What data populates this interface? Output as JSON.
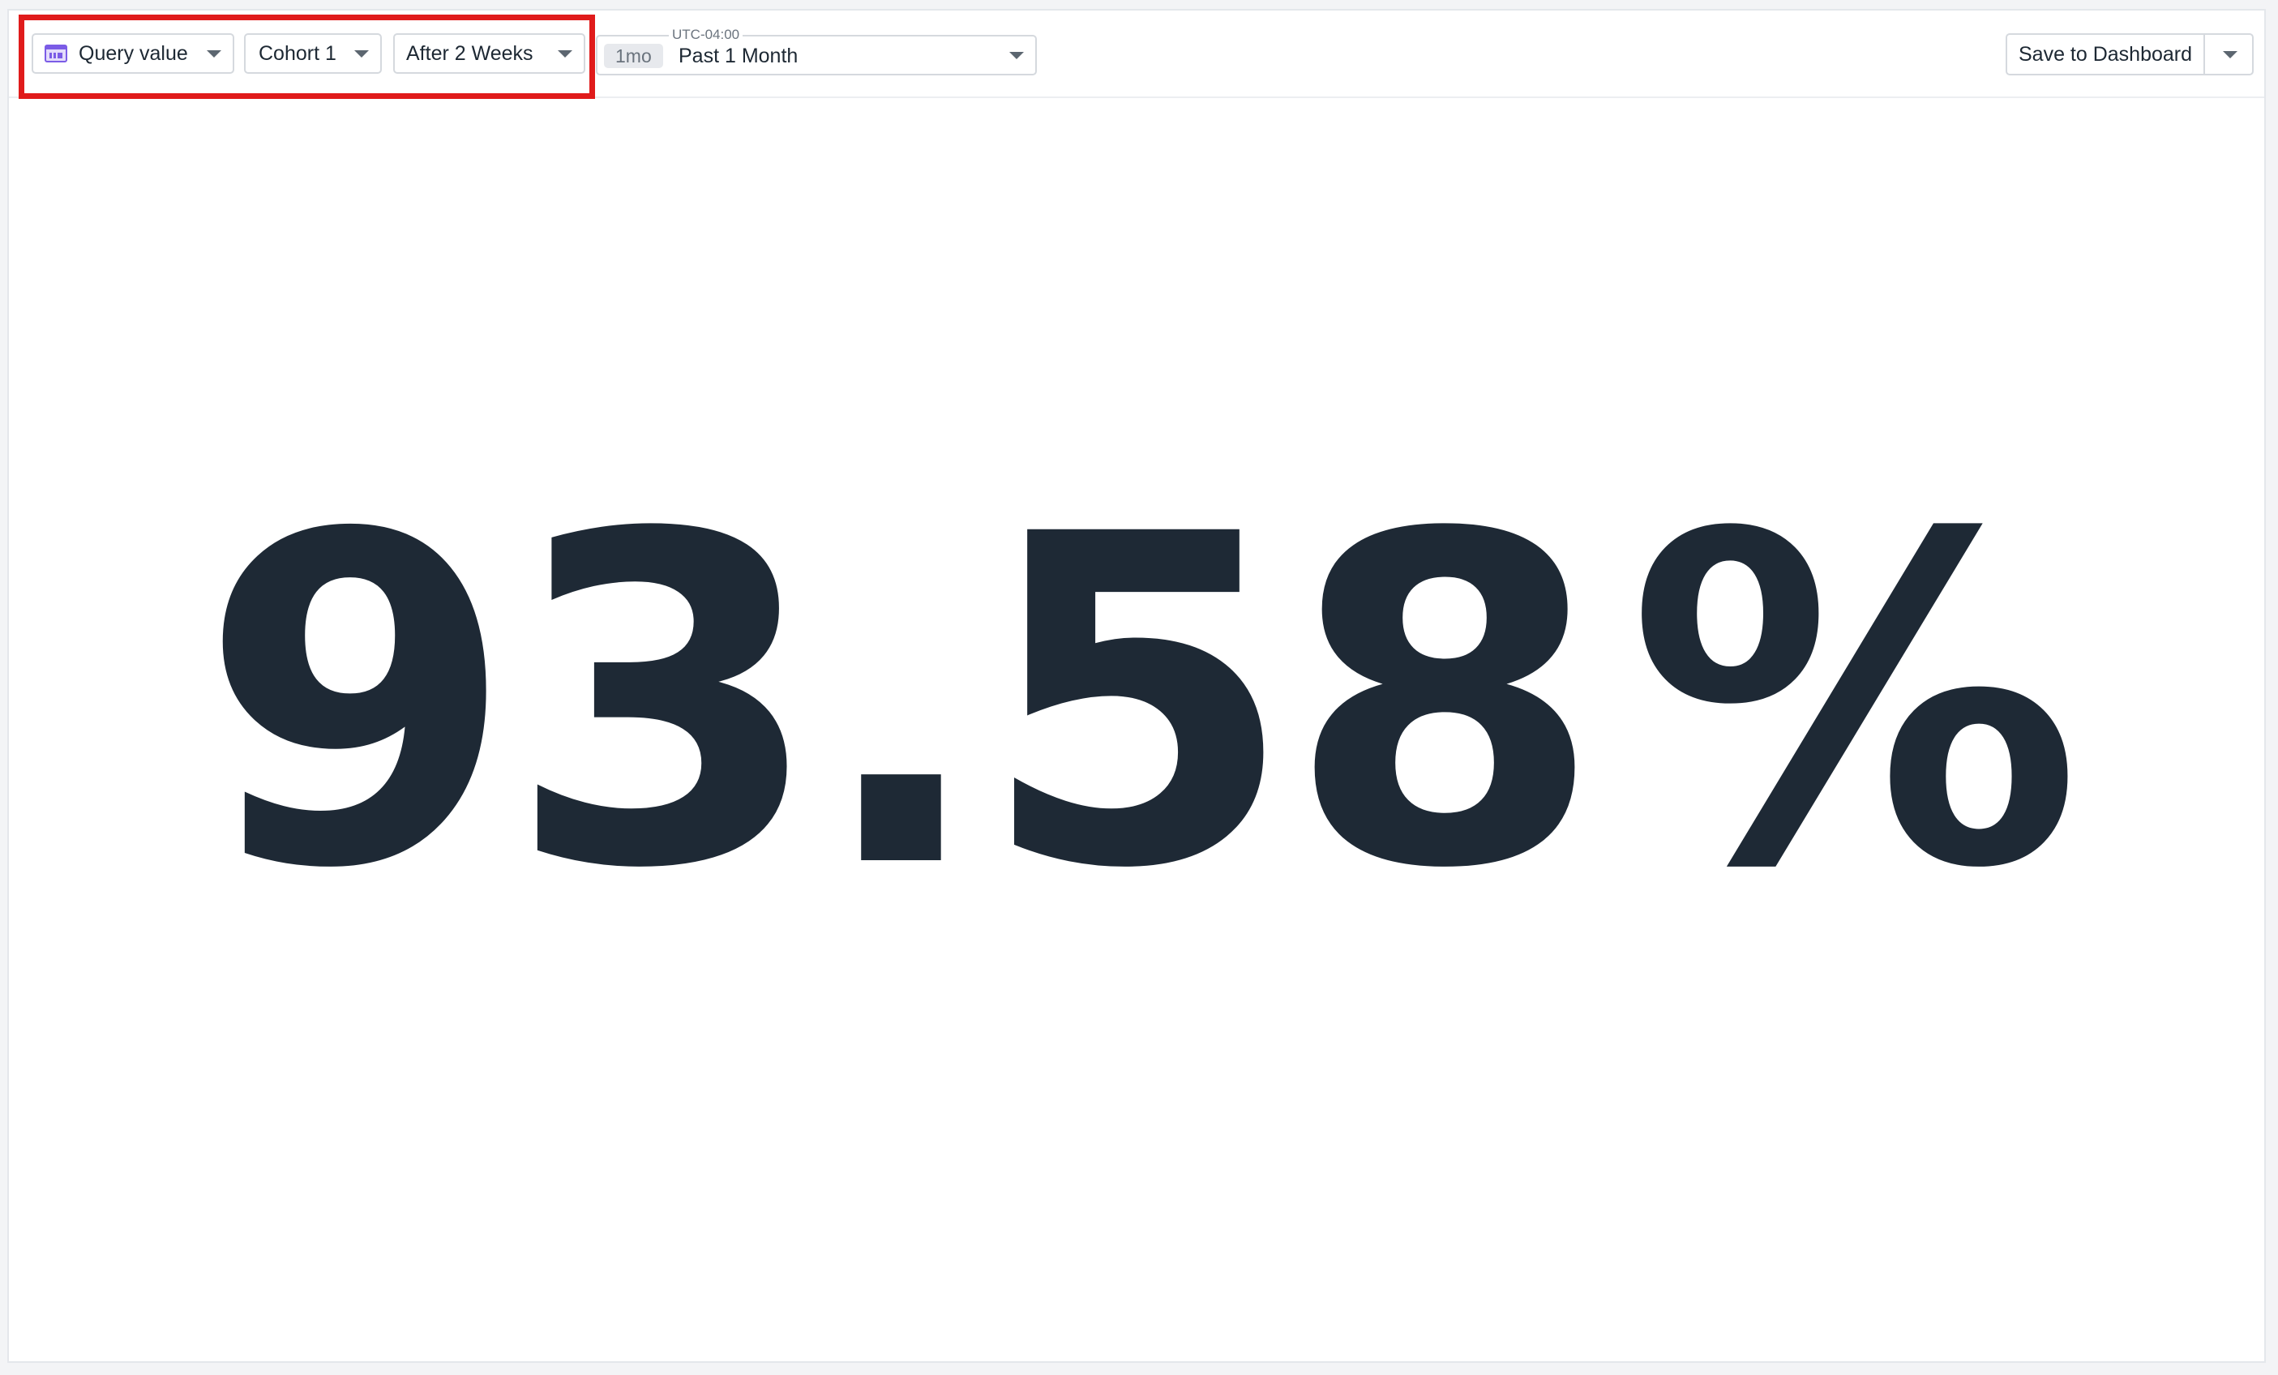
{
  "toolbar": {
    "visualization_label": "Query value",
    "visualization_icon": "query-value-icon",
    "cohort_label": "Cohort 1",
    "period_label": "After 2 Weeks",
    "time": {
      "timezone": "UTC-04:00",
      "chip": "1mo",
      "range": "Past 1 Month"
    },
    "save_label": "Save to Dashboard"
  },
  "metric": {
    "value": "93.58",
    "unit": "%"
  },
  "colors": {
    "highlight": "#e01b1b",
    "value_text": "#1e2935",
    "icon_purple": "#7b5ce6"
  }
}
